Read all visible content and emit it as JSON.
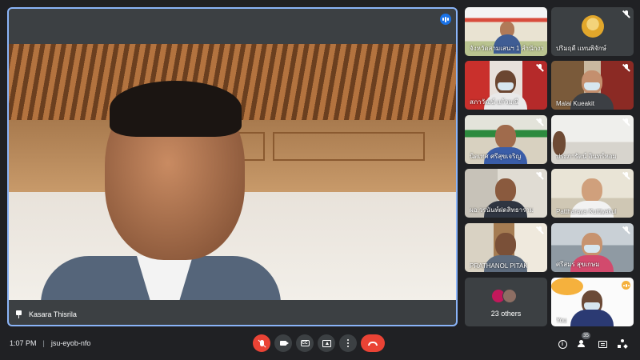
{
  "meeting": {
    "time": "1:07 PM",
    "separator": "|",
    "code": "jsu-eyob-nfo"
  },
  "main_speaker": {
    "name": "Kasara Thisrila"
  },
  "participants": [
    {
      "name": "จังหวัดสามเสนฯ 1 สำนักงานเขตพื้นที่",
      "muted": false
    },
    {
      "name": "ปริมฤดี แทนพิจักษ์",
      "muted": true
    },
    {
      "name": "สภาวัฒน์ แก้วมณี",
      "muted": true
    },
    {
      "name": "Malai Kueakit",
      "muted": true
    },
    {
      "name": "นิตเทศ ศรีสุขเจริญ",
      "muted": true
    },
    {
      "name": "ประภารัตน์ อินทร์หอม",
      "muted": true
    },
    {
      "name": "ผอ.วรนันท์ฝดสิทธาราม",
      "muted": true
    },
    {
      "name": "Pattharaya Kuttiyakul",
      "muted": true
    },
    {
      "name": "PRATHANOL PITAK",
      "muted": true
    },
    {
      "name": "ศรีสมร สุขเกษม",
      "muted": true
    },
    {
      "name": "You",
      "muted": false
    }
  ],
  "others": {
    "label": "23 others"
  },
  "toolbar": {
    "mic_icon": "mic-off-icon",
    "camera_icon": "camera-icon",
    "captions_icon": "closed-captions-icon",
    "captions_text": "CC",
    "present_icon": "present-icon",
    "more_icon": "more-options-icon",
    "leave_icon": "leave-call-icon"
  },
  "right_controls": {
    "people_count": "35"
  },
  "colors": {
    "background": "#202124",
    "tile": "#3c4043",
    "active_border": "#8ab4f8",
    "danger": "#ea4335",
    "speaking": "#1a73e8"
  }
}
